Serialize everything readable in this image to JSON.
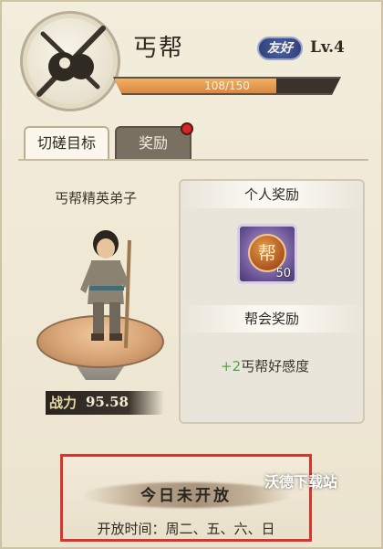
{
  "header": {
    "sect_name": "丐帮",
    "relation_badge": "友好",
    "level": "Lv.4",
    "exp_text": "108/150",
    "exp_progress": 0.72,
    "emblem_icon": "beggar-sect-gourd-emblem"
  },
  "tabs": [
    {
      "label": "切磋目标",
      "active": true
    },
    {
      "label": "奖励",
      "active": false,
      "has_alert": true
    }
  ],
  "target": {
    "disciple_name": "丐帮精英弟子",
    "power_icon_text": "战力",
    "power_value": "95.58"
  },
  "rewards": {
    "personal_title": "个人奖励",
    "personal_item": {
      "icon_char": "帮",
      "count": "50",
      "frame_color": "#6a5395"
    },
    "guild_title": "帮会奖励",
    "guild_bonus_value": "+2",
    "guild_bonus_label": "丐帮好感度"
  },
  "notice": {
    "title": "今日未开放",
    "schedule": "开放时间：周二、五、六、日"
  },
  "watermark": "沃德下载站",
  "colors": {
    "accent_exp": "#d9873e",
    "alert_dot": "#d3262b",
    "highlight_box": "#d9332c",
    "bonus_green": "#4ea64b"
  }
}
